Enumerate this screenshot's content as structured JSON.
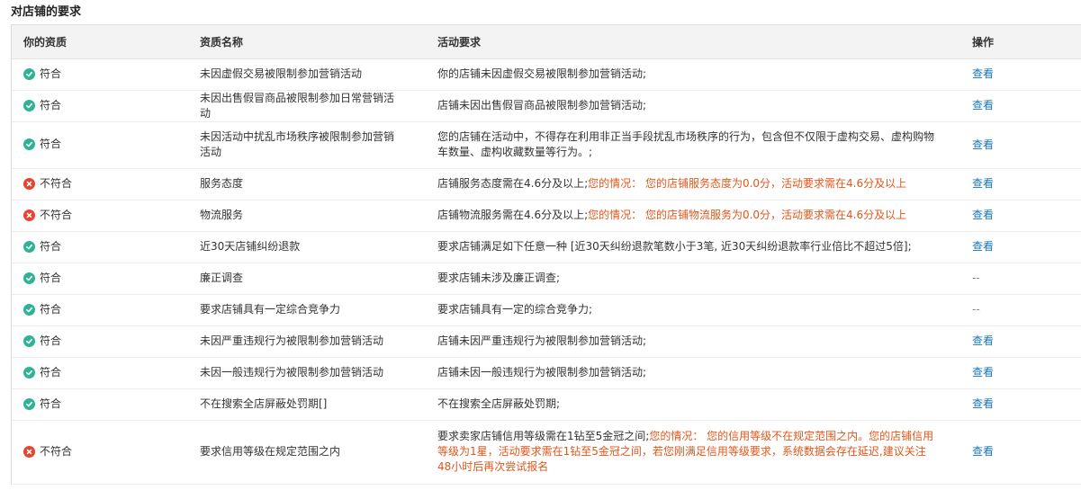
{
  "section_title": "对店铺的要求",
  "columns": [
    "你的资质",
    "资质名称",
    "活动要求",
    "操作"
  ],
  "icons": {
    "pass": "check-circle-icon",
    "fail": "cross-circle-icon"
  },
  "colors": {
    "pass": "#2fb394",
    "fail": "#e8432e",
    "warning_text": "#e2561b",
    "link": "#1a76b8"
  },
  "rows": [
    {
      "status": "pass",
      "status_label": "符合",
      "name": "未因虚假交易被限制参加营销活动",
      "requirement": "你的店铺未因虚假交易被限制参加营销活动;",
      "warning": "",
      "action": "查看"
    },
    {
      "status": "pass",
      "status_label": "符合",
      "name": "未因出售假冒商品被限制参加日常营销活动",
      "requirement": "店铺未因出售假冒商品被限制参加营销活动;",
      "warning": "",
      "action": "查看"
    },
    {
      "status": "pass",
      "status_label": "符合",
      "name": "未因活动中扰乱市场秩序被限制参加营销活动",
      "requirement": "您的店铺在活动中，不得存在利用非正当手段扰乱市场秩序的行为，包含但不仅限于虚构交易、虚构购物车数量、虚构收藏数量等行为。;",
      "warning": "",
      "action": "查看"
    },
    {
      "status": "fail",
      "status_label": "不符合",
      "name": "服务态度",
      "requirement": "店铺服务态度需在4.6分及以上;",
      "warning": "您的情况： 您的店铺服务态度为0.0分，活动要求需在4.6分及以上",
      "action": "查看"
    },
    {
      "status": "fail",
      "status_label": "不符合",
      "name": "物流服务",
      "requirement": "店铺物流服务需在4.6分及以上;",
      "warning": "您的情况： 您的店铺物流服务为0.0分，活动要求需在4.6分及以上",
      "action": "查看"
    },
    {
      "status": "pass",
      "status_label": "符合",
      "name": "近30天店铺纠纷退款",
      "requirement": "要求店铺满足如下任意一种 [近30天纠纷退款笔数小于3笔, 近30天纠纷退款率行业倍比不超过5倍];",
      "warning": "",
      "action": "查看"
    },
    {
      "status": "pass",
      "status_label": "符合",
      "name": "廉正调查",
      "requirement": "要求店铺未涉及廉正调查;",
      "warning": "",
      "action": "--"
    },
    {
      "status": "pass",
      "status_label": "符合",
      "name": "要求店铺具有一定综合竞争力",
      "requirement": "要求店铺具有一定的综合竞争力;",
      "warning": "",
      "action": "--"
    },
    {
      "status": "pass",
      "status_label": "符合",
      "name": "未因严重违规行为被限制参加营销活动",
      "requirement": "店铺未因严重违规行为被限制参加营销活动;",
      "warning": "",
      "action": "查看"
    },
    {
      "status": "pass",
      "status_label": "符合",
      "name": "未因一般违规行为被限制参加营销活动",
      "requirement": "店铺未因一般违规行为被限制参加营销活动;",
      "warning": "",
      "action": "查看"
    },
    {
      "status": "pass",
      "status_label": "符合",
      "name": "不在搜索全店屏蔽处罚期[]",
      "requirement": "不在搜索全店屏蔽处罚期;",
      "warning": "",
      "action": "查看"
    },
    {
      "status": "fail",
      "status_label": "不符合",
      "name": "要求信用等级在规定范围之内",
      "requirement": "要求卖家店铺信用等级需在1钻至5金冠之间;",
      "warning": "您的情况： 您的信用等级不在规定范围之内。您的店铺信用等级为1星，活动要求需在1钻至5金冠之间，若您刚满足信用等级要求，系统数据会存在延迟,建议关注48小时后再次尝试报名",
      "action": "查看"
    }
  ]
}
